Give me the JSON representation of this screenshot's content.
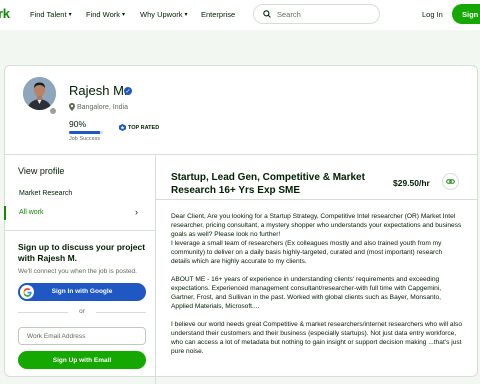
{
  "nav": {
    "logo": "rk",
    "find_talent": "Find Talent",
    "find_work": "Find Work",
    "why_upwork": "Why Upwork",
    "enterprise": "Enterprise",
    "search_placeholder": "Search",
    "login": "Log In",
    "signup": "Sign"
  },
  "profile": {
    "name": "Rajesh M.",
    "location": "Bangalore, India",
    "job_success_value": "90%",
    "job_success_fraction": 0.9,
    "job_success_label": "Job Success",
    "badge": "TOP RATED"
  },
  "sidebar": {
    "view_profile": "View profile",
    "items": [
      {
        "label": "Market Research"
      },
      {
        "label": "All work"
      }
    ],
    "signup": {
      "title": "Sign up to discuss your project with Rajesh M.",
      "subtitle": "We'll connect you when the job is posted.",
      "google_button": "Sign In with Google",
      "or": "or",
      "email_placeholder": "Work Email Address",
      "email_button": "Sign Up with Email"
    }
  },
  "project": {
    "title": "Startup, Lead Gen, Competitive & Market Research 16+ Yrs Exp SME",
    "rate": "$29.50/hr",
    "description": [
      "Dear Client, Are you looking for a Startup Strategy, Competitive Intel researcher (OR) Market Intel researcher, pricing consultant, a mystery shopper who understands your expectations and business goals as well? Please look no further!",
      "I leverage a small team of researchers (Ex colleagues mostly and also trained youth from my community) to deliver on a daily basis highly-targeted, curated and (most important) research details which are highly accurate to my clients.",
      "ABOUT ME - 16+ years of experience in understanding clients' requirements and exceeding expectations. Experienced management consultant/researcher-with full time with Capgemini, Gartner, Frost, and Sullivan in the past. Worked with global clients such as Bayer, Monsanto, Applied Materials, Microsoft....",
      "I believe our world needs great Competitive & market researchers/internet researchers who will also understand their customers and their business (especially startups). Not just data entry workforce, who can access a lot of metadata but nothing to gain insight or support decision making ...that's just pure noise."
    ]
  },
  "colors": {
    "brand_green": "#14a800",
    "link_green": "#108a00",
    "blue": "#1f57c3",
    "border": "#d5e0d5"
  }
}
